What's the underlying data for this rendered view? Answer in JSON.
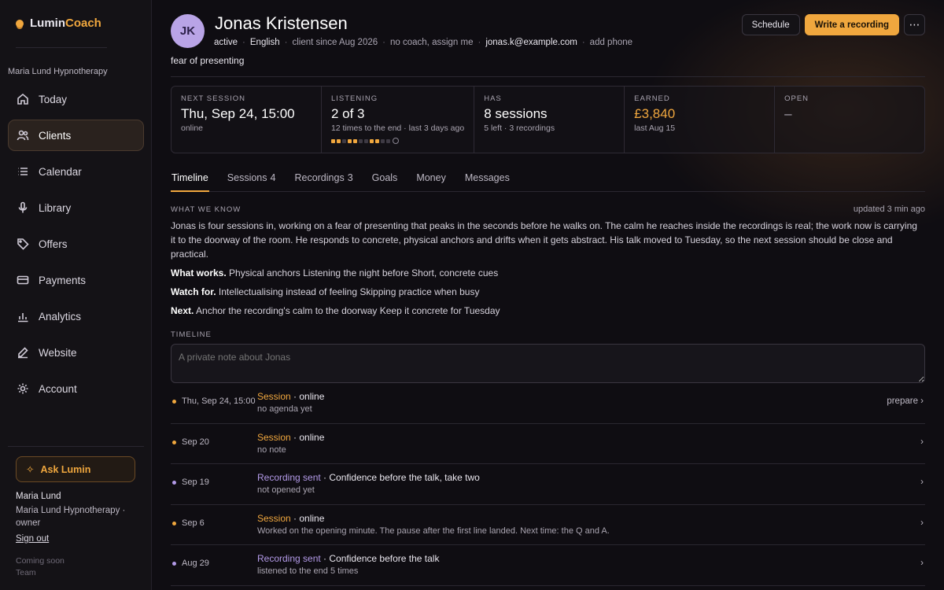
{
  "brand": {
    "name_a": "Lumin",
    "name_b": "Coach"
  },
  "sidebar": {
    "practice": "Maria Lund Hypnotherapy",
    "items": [
      {
        "label": "Today",
        "icon": "home-icon"
      },
      {
        "label": "Clients",
        "icon": "users-icon"
      },
      {
        "label": "Calendar",
        "icon": "list-icon"
      },
      {
        "label": "Library",
        "icon": "mic-icon"
      },
      {
        "label": "Offers",
        "icon": "tag-icon"
      },
      {
        "label": "Payments",
        "icon": "card-icon"
      },
      {
        "label": "Analytics",
        "icon": "chart-icon"
      },
      {
        "label": "Website",
        "icon": "edit-icon"
      },
      {
        "label": "Account",
        "icon": "gear-icon"
      }
    ],
    "active": "Clients",
    "ask_label": "Ask Lumin",
    "user_name": "Maria Lund",
    "user_org": "Maria Lund Hypnotherapy · owner",
    "sign_out": "Sign out",
    "coming_soon": "Coming soon",
    "team": "Team"
  },
  "client": {
    "initials": "JK",
    "name": "Jonas Kristensen",
    "status": "active",
    "language": "English",
    "since": "client since Aug 2026",
    "coach": "no coach, assign me",
    "email": "jonas.k@example.com",
    "phone": "add phone",
    "topic": "fear of presenting"
  },
  "actions": {
    "schedule": "Schedule",
    "write": "Write a recording",
    "more": "⋯"
  },
  "stats": {
    "next": {
      "label": "NEXT SESSION",
      "value": "Thu, Sep 24, 15:00",
      "sub": "online"
    },
    "listening": {
      "label": "LISTENING",
      "value": "2 of 3",
      "sub": "12 times to the end · last 3 days ago",
      "filled": [
        true,
        true,
        false,
        true,
        true,
        false,
        false,
        true,
        true,
        false,
        false
      ]
    },
    "has": {
      "label": "HAS",
      "value": "8 sessions",
      "sub": "5 left · 3 recordings"
    },
    "earned": {
      "label": "EARNED",
      "value": "£3,840",
      "sub": "last Aug 15"
    },
    "open": {
      "label": "OPEN",
      "value": "–"
    }
  },
  "tabs": [
    {
      "label": "Timeline",
      "count": ""
    },
    {
      "label": "Sessions",
      "count": "4"
    },
    {
      "label": "Recordings",
      "count": "3"
    },
    {
      "label": "Goals",
      "count": ""
    },
    {
      "label": "Money",
      "count": ""
    },
    {
      "label": "Messages",
      "count": ""
    }
  ],
  "know": {
    "label": "WHAT WE KNOW",
    "updated": "updated 3 min ago",
    "text": "Jonas is four sessions in, working on a fear of presenting that peaks in the seconds before he walks on. The calm he reaches inside the recordings is real; the work now is carrying it to the doorway of the room. He responds to concrete, physical anchors and drifts when it gets abstract. His talk moved to Tuesday, so the next session should be close and practical.",
    "works_label": "What works.",
    "works": "Physical anchors Listening the night before Short, concrete cues",
    "watch_label": "Watch for.",
    "watch": "Intellectualising instead of feeling Skipping practice when busy",
    "next_label": "Next.",
    "next": "Anchor the recording's calm to the doorway Keep it concrete for Tuesday"
  },
  "timeline": {
    "label": "TIMELINE",
    "placeholder": "A private note about Jonas",
    "items": [
      {
        "date": "Thu, Sep 24, 15:00",
        "kind": "Session",
        "rest": " · online",
        "sub": "no agenda yet",
        "action": "prepare ›",
        "color": "#f0a73e"
      },
      {
        "date": "Sep 20",
        "kind": "Session",
        "rest": " · online",
        "sub": "no note",
        "action": "›",
        "color": "#f0a73e"
      },
      {
        "date": "Sep 19",
        "kind": "Recording sent",
        "rest": " · Confidence before the talk, take two",
        "sub": "not opened yet",
        "action": "›",
        "color": "#b39ae8"
      },
      {
        "date": "Sep 6",
        "kind": "Session",
        "rest": " · online",
        "sub": "Worked on the opening minute. The pause after the first line landed. Next time: the Q and A.",
        "action": "›",
        "color": "#f0a73e"
      },
      {
        "date": "Aug 29",
        "kind": "Recording sent",
        "rest": " · Confidence before the talk",
        "sub": "listened to the end 5 times",
        "action": "›",
        "color": "#b39ae8"
      }
    ]
  }
}
